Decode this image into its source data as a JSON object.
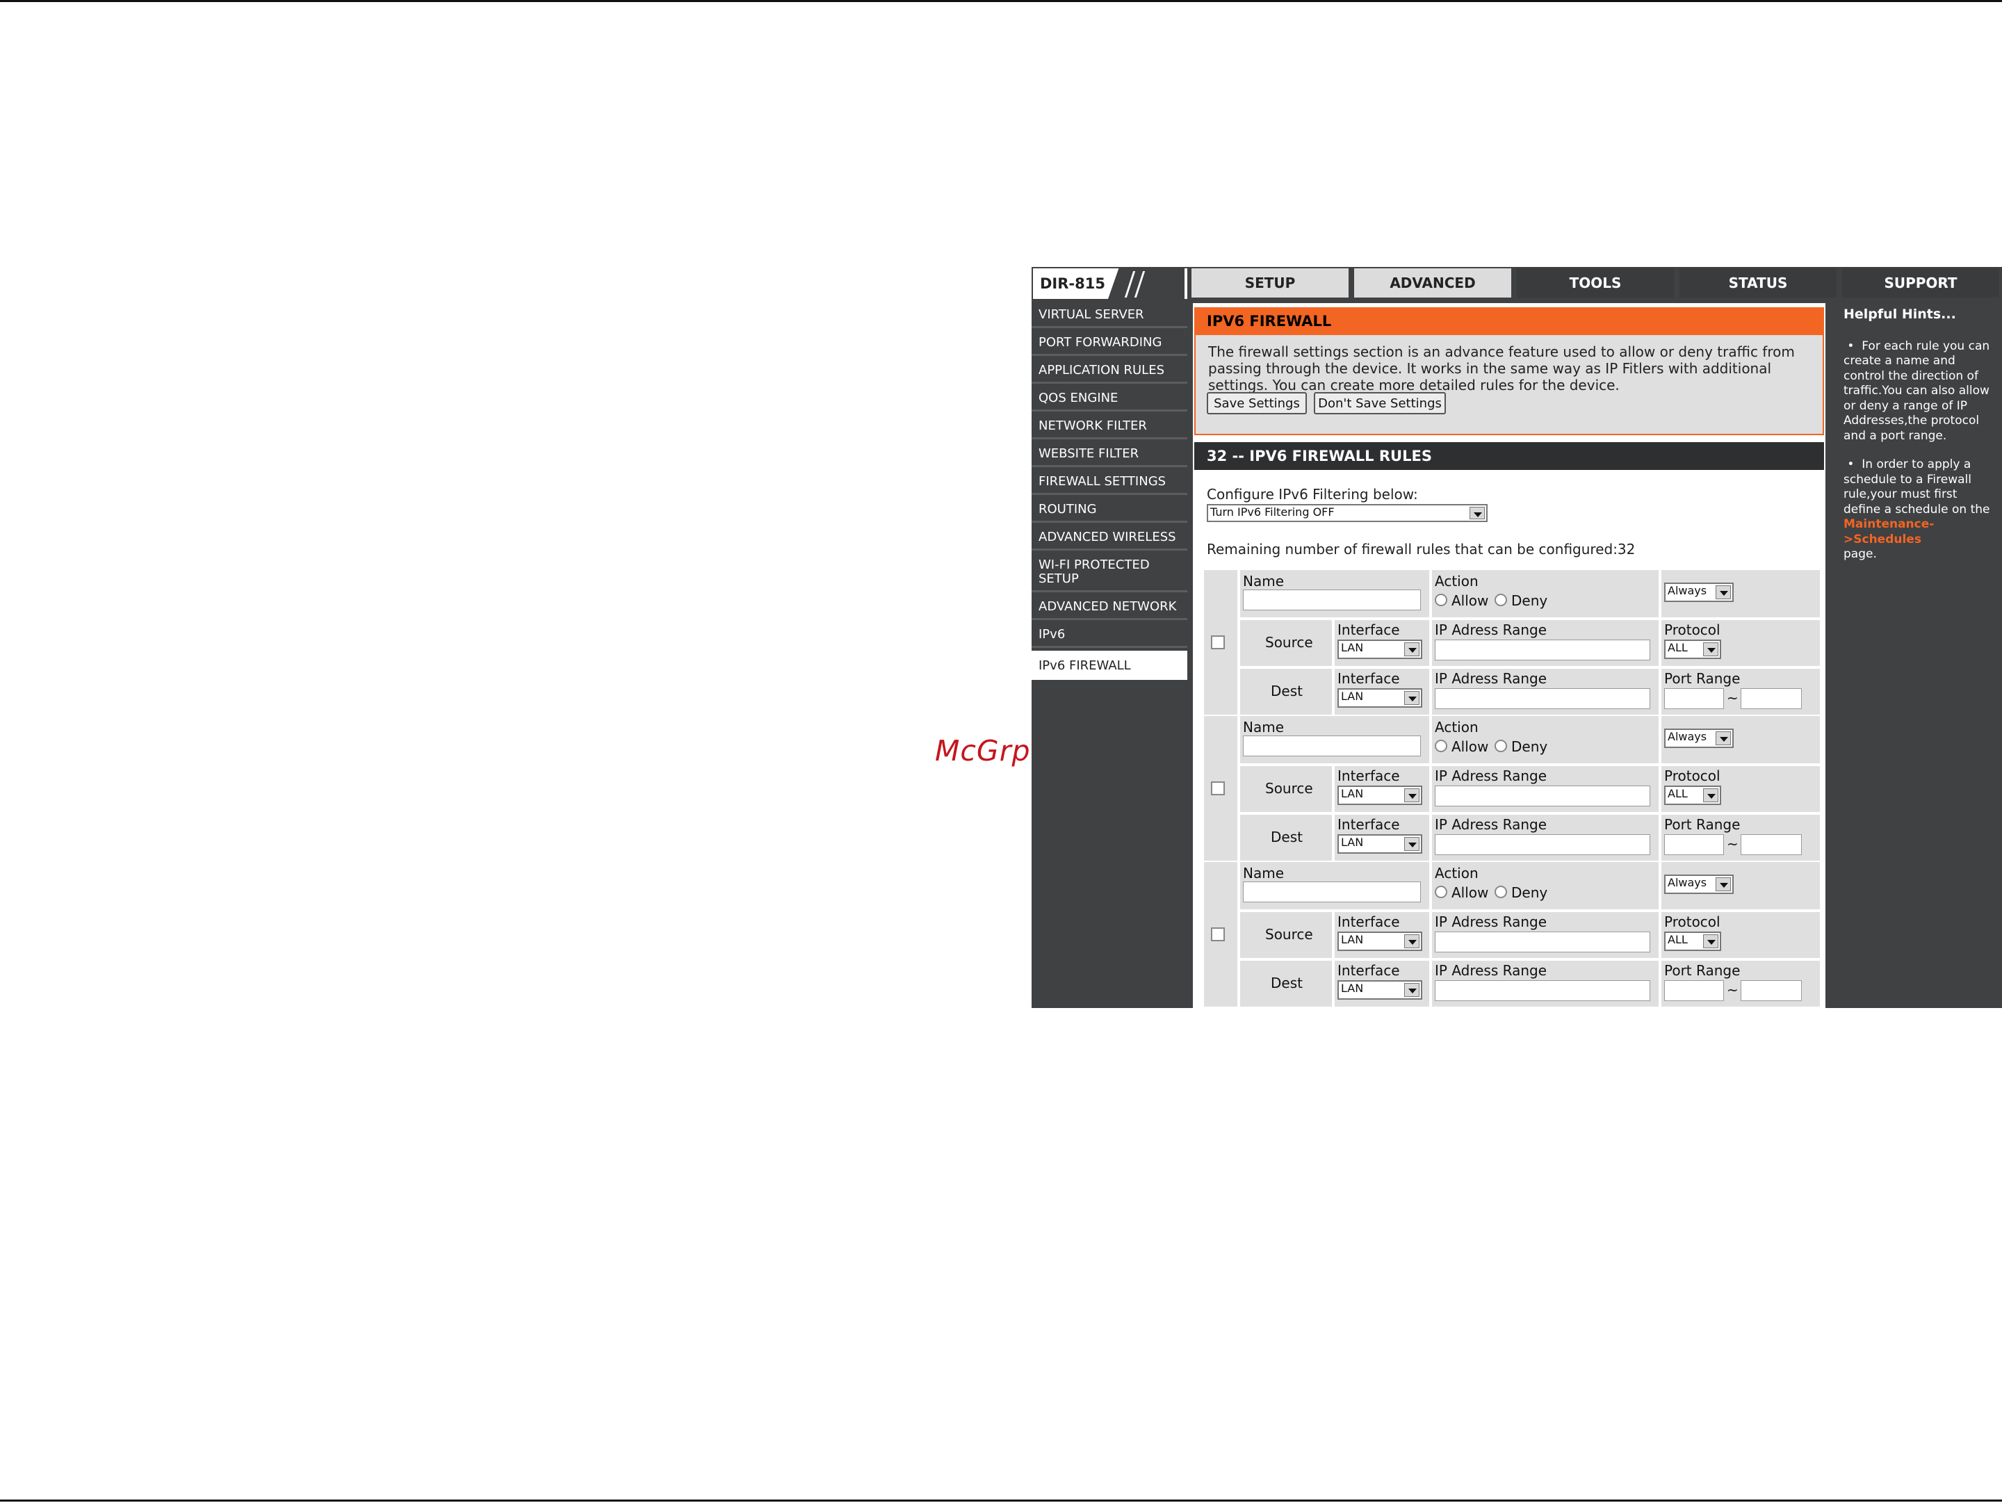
{
  "watermark": "McGrp.Ru",
  "logo": "DIR-815",
  "tabs": [
    "SETUP",
    "ADVANCED",
    "TOOLS",
    "STATUS",
    "SUPPORT"
  ],
  "sidebar": {
    "items": [
      "VIRTUAL SERVER",
      "PORT FORWARDING",
      "APPLICATION RULES",
      "QOS ENGINE",
      "NETWORK FILTER",
      "WEBSITE FILTER",
      "FIREWALL SETTINGS",
      "ROUTING",
      "ADVANCED WIRELESS",
      "WI-FI PROTECTED SETUP",
      "ADVANCED NETWORK",
      "IPv6",
      "IPv6 FIREWALL"
    ],
    "active": "IPv6 FIREWALL"
  },
  "firewall": {
    "title": "IPV6 FIREWALL",
    "description": "The firewall settings section is an advance feature used to allow or deny traffic from passing through the device. It works in the same way as IP Fitlers with additional settings. You can create more detailed rules for the device.",
    "save_label": "Save Settings",
    "dont_save_label": "Don't Save Settings"
  },
  "rules_section": {
    "title": "32 -- IPV6 FIREWALL RULES",
    "config_label": "Configure IPv6 Filtering below:",
    "config_value": "Turn IPv6 Filtering OFF",
    "remaining": "Remaining number of firewall rules that can be configured:32"
  },
  "rule_labels": {
    "name": "Name",
    "action": "Action",
    "allow": "Allow",
    "deny": "Deny",
    "schedule": "Always",
    "source": "Source",
    "dest": "Dest",
    "interface": "Interface",
    "interface_value": "LAN",
    "ip_range": "IP Adress Range",
    "protocol": "Protocol",
    "protocol_value": "ALL",
    "port_range": "Port Range",
    "tilde": "~"
  },
  "rule_count_visible": 3,
  "hints": {
    "title": "Helpful Hints...",
    "hint1": "For each rule you can create a name and control the direction of traffic.You can also allow or deny a range of IP Addresses,the protocol and a port range.",
    "hint2_pre": "In order to apply a schedule to a Firewall rule,your must first define a schedule on the",
    "hint2_link": "Maintenance->Schedules",
    "hint2_post": "page."
  },
  "colors": {
    "accent": "#f26522",
    "panel_dark": "#404143",
    "watermark": "#c5151c"
  }
}
